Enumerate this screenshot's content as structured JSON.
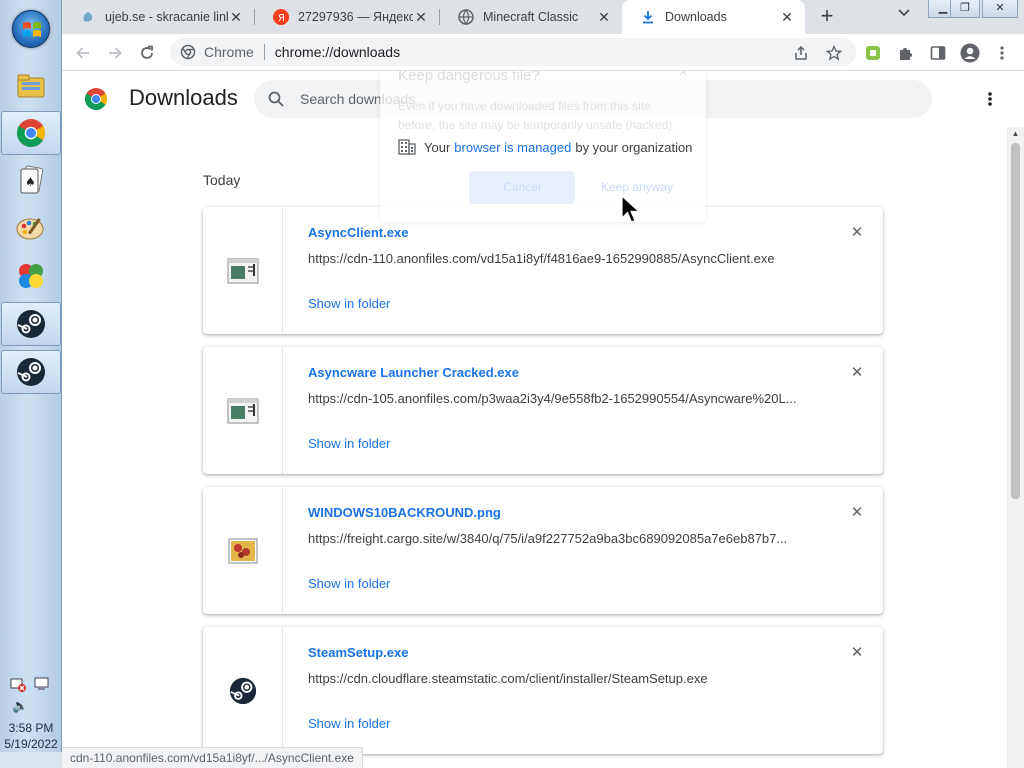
{
  "taskbar": {
    "apps": [
      {
        "name": "file-manager",
        "active": false
      },
      {
        "name": "chrome",
        "active": true
      },
      {
        "name": "solitaire",
        "active": false
      },
      {
        "name": "paint",
        "active": false
      },
      {
        "name": "puzzle-game",
        "active": false
      },
      {
        "name": "steam",
        "active": true
      },
      {
        "name": "steam",
        "active": true
      }
    ],
    "clock_time": "3:58 PM",
    "clock_date": "5/19/2022"
  },
  "tabs": [
    {
      "title": "ujeb.se - skracanie link",
      "active": false,
      "icon": "ujeb-icon"
    },
    {
      "title": "27297936 — Яндекс:",
      "active": false,
      "icon": "yandex-icon"
    },
    {
      "title": "Minecraft Classic",
      "active": false,
      "icon": "globe-icon"
    },
    {
      "title": "Downloads",
      "active": true,
      "icon": "download-icon"
    }
  ],
  "omnibox": {
    "chip": "Chrome",
    "url": "chrome://downloads"
  },
  "downloads": {
    "title": "Downloads",
    "search_placeholder": "Search downloads",
    "section": "Today",
    "items": [
      {
        "file": "AsyncClient.exe",
        "url": "https://cdn-110.anonfiles.com/vd15a1i8yf/f4816ae9-1652990885/AsyncClient.exe",
        "action": "Show in folder",
        "icon": "exe-icon"
      },
      {
        "file": "Asyncware Launcher Cracked.exe",
        "url": "https://cdn-105.anonfiles.com/p3waa2i3y4/9e558fb2-1652990554/Asyncware%20L...",
        "action": "Show in folder",
        "icon": "exe-icon"
      },
      {
        "file": "WINDOWS10BACKROUND.png",
        "url": "https://freight.cargo.site/w/3840/q/75/i/a9f227752a9ba3bc689092085a7e6eb87b7...",
        "action": "Show in folder",
        "icon": "image-icon"
      },
      {
        "file": "SteamSetup.exe",
        "url": "https://cdn.cloudflare.steamstatic.com/client/installer/SteamSetup.exe",
        "action": "Show in folder",
        "icon": "steam-icon"
      }
    ]
  },
  "dialog": {
    "title": "Keep dangerous file?",
    "body": "Even if you have downloaded files from this site before, the site may be temporarily unsafe (hacked).",
    "managed_prefix": "Your",
    "managed_link": "browser is managed",
    "managed_suffix": "by your organization",
    "cancel": "Cancel",
    "keep": "Keep anyway"
  },
  "status_bar": "cdn-110.anonfiles.com/vd15a1i8yf/.../AsyncClient.exe",
  "colors": {
    "accent": "#1a73e8",
    "tabstrip": "#dee1e6",
    "search_bg": "#f1f3f4"
  }
}
